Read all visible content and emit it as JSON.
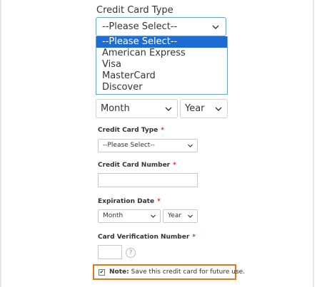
{
  "zoomed": {
    "title": "Credit Card Type",
    "select_value": "--Please Select--",
    "options": [
      "--Please Select--",
      "American Express",
      "Visa",
      "MasterCard",
      "Discover"
    ],
    "month_value": "Month",
    "year_value": "Year"
  },
  "form": {
    "cc_type_label": "Credit Card Type",
    "cc_type_value": "--Please Select--",
    "cc_number_label": "Credit Card Number",
    "cc_number_value": "",
    "exp_label": "Expiration Date",
    "exp_month_value": "Month",
    "exp_year_value": "Year",
    "cvv_label": "Card Verification Number",
    "cvv_value": "",
    "help_symbol": "?",
    "required_marker": "*"
  },
  "save_note": {
    "strong": "Note:",
    "text": "Save this credit card for future use.",
    "checked": true,
    "check_symbol": "✔"
  },
  "colors": {
    "accent_blue": "#1e6cd3",
    "focus_border": "#6aa3d6",
    "highlight_orange": "#e8751a",
    "required_red": "#e02b27"
  }
}
